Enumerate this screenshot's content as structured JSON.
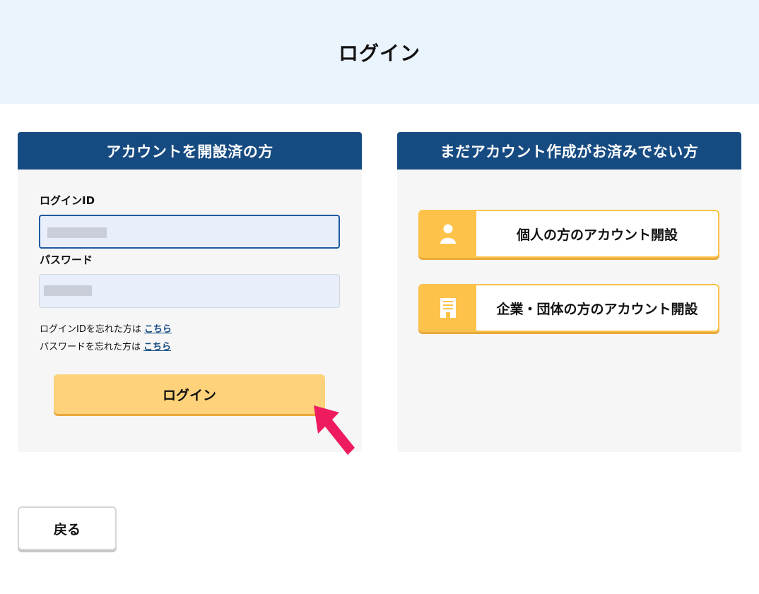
{
  "page": {
    "title": "ログイン"
  },
  "existing": {
    "heading": "アカウントを開設済の方",
    "login_id_label": "ログインID",
    "password_label": "パスワード",
    "forgot_id_text": "ログインIDを忘れた方は",
    "forgot_password_text": "パスワードを忘れた方は",
    "here_link": "こちら",
    "login_button": "ログイン"
  },
  "new": {
    "heading": "まだアカウント作成がお済みでない方",
    "personal_button": "個人の方のアカウント開設",
    "personal_icon": "person-icon",
    "corporate_button": "企業・団体の方のアカウント開設",
    "corporate_icon": "building-icon"
  },
  "footer": {
    "back_button": "戻る"
  },
  "colors": {
    "hero_bg": "#eaf4fd",
    "panel_header": "#164b82",
    "accent_yellow": "#fdc24a",
    "login_button": "#fdd27a",
    "pointer_arrow": "#ee1b5f"
  }
}
